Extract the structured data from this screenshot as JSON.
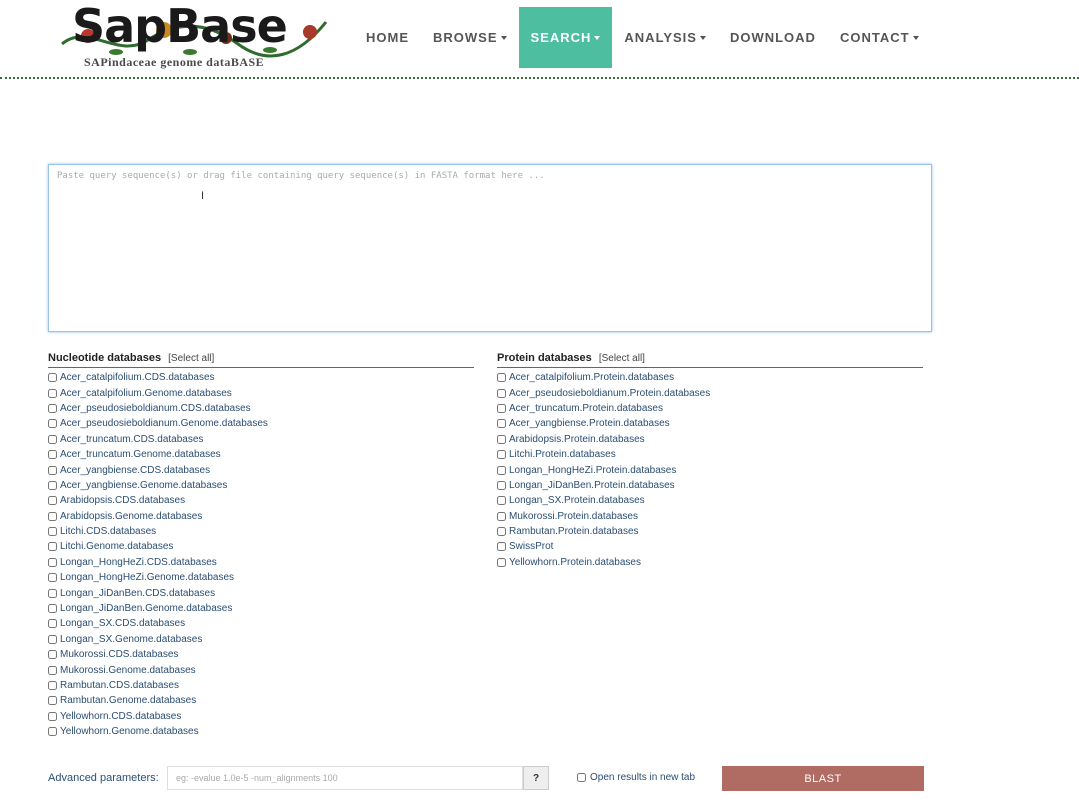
{
  "header": {
    "logo_text": "SapBase",
    "logo_subtitle": "SAPindaceae genome dataBASE",
    "nav": [
      {
        "label": "HOME",
        "has_menu": false
      },
      {
        "label": "BROWSE",
        "has_menu": true
      },
      {
        "label": "SEARCH",
        "has_menu": true,
        "active": true
      },
      {
        "label": "ANALYSIS",
        "has_menu": true
      },
      {
        "label": "DOWNLOAD",
        "has_menu": false
      },
      {
        "label": "CONTACT",
        "has_menu": true
      }
    ]
  },
  "query": {
    "value": "",
    "placeholder": "Paste query sequence(s) or drag file containing query sequence(s) in FASTA format here ..."
  },
  "nucleotide": {
    "title": "Nucleotide databases",
    "select_all": "[Select all]",
    "items": [
      "Acer_catalpifolium.CDS.databases",
      "Acer_catalpifolium.Genome.databases",
      "Acer_pseudosieboldianum.CDS.databases",
      "Acer_pseudosieboldianum.Genome.databases",
      "Acer_truncatum.CDS.databases",
      "Acer_truncatum.Genome.databases",
      "Acer_yangbiense.CDS.databases",
      "Acer_yangbiense.Genome.databases",
      "Arabidopsis.CDS.databases",
      "Arabidopsis.Genome.databases",
      "Litchi.CDS.databases",
      "Litchi.Genome.databases",
      "Longan_HongHeZi.CDS.databases",
      "Longan_HongHeZi.Genome.databases",
      "Longan_JiDanBen.CDS.databases",
      "Longan_JiDanBen.Genome.databases",
      "Longan_SX.CDS.databases",
      "Longan_SX.Genome.databases",
      "Mukorossi.CDS.databases",
      "Mukorossi.Genome.databases",
      "Rambutan.CDS.databases",
      "Rambutan.Genome.databases",
      "Yellowhorn.CDS.databases",
      "Yellowhorn.Genome.databases"
    ]
  },
  "protein": {
    "title": "Protein databases",
    "select_all": "[Select all]",
    "items": [
      "Acer_catalpifolium.Protein.databases",
      "Acer_pseudosieboldianum.Protein.databases",
      "Acer_truncatum.Protein.databases",
      "Acer_yangbiense.Protein.databases",
      "Arabidopsis.Protein.databases",
      "Litchi.Protein.databases",
      "Longan_HongHeZi.Protein.databases",
      "Longan_JiDanBen.Protein.databases",
      "Longan_SX.Protein.databases",
      "Mukorossi.Protein.databases",
      "Rambutan.Protein.databases",
      "SwissProt",
      "Yellowhorn.Protein.databases"
    ]
  },
  "advanced": {
    "label": "Advanced parameters:",
    "value": "",
    "placeholder": "eg: -evalue 1.0e-5 -num_alignments 100",
    "help_label": "?"
  },
  "new_tab": {
    "label": "Open results in new tab",
    "checked": false
  },
  "blast": {
    "label": "BLAST"
  },
  "colors": {
    "nav_active": "#4dbfa0",
    "blast_button": "#b06b62",
    "section_rule": "#b04a28",
    "link_text": "#2b4e72"
  },
  "icons": {
    "logo": "sapbase-logo-icon",
    "text_cursor": "ibeam-cursor-icon"
  }
}
